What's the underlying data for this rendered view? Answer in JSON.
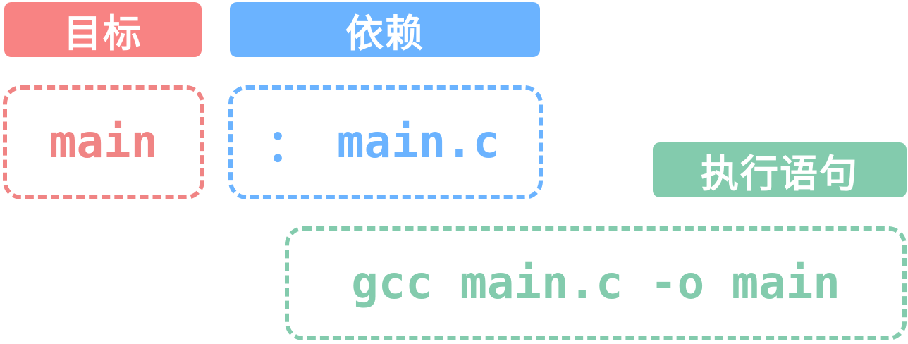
{
  "labels": {
    "target": "目标",
    "dependency": "依赖",
    "command": "执行语句"
  },
  "rule": {
    "target": "main",
    "separator": "：",
    "dependency": "main.c",
    "command": "gcc main.c -o main"
  },
  "colors": {
    "target": "#f88383",
    "dependency": "#6bb3ff",
    "command": "#83cbad"
  }
}
